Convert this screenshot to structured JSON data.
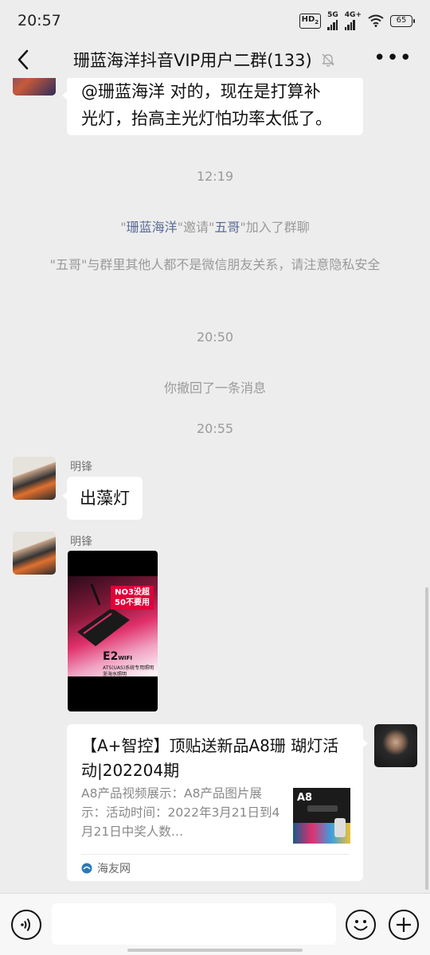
{
  "status_bar": {
    "time": "20:57",
    "hd_label": "HD",
    "hd_sub": "2",
    "net1": "5G",
    "net2": "4G+",
    "battery": "65"
  },
  "nav": {
    "title": "珊蓝海洋抖音VIP用户二群(133)",
    "muted": true
  },
  "messages": {
    "m1_text_line1": "@珊蓝海洋 对的，现在是打算补",
    "m1_text_line2": "光灯，抬高主光灯怕功率太低了。",
    "time1": "12:19",
    "invite_q1": "\"",
    "invite_inviter": "珊蓝海洋",
    "invite_mid": "\"邀请\"",
    "invite_invitee": "五哥",
    "invite_end": "\"加入了群聊",
    "privacy_note": "\"五哥\"与群里其他人都不是微信朋友关系，请注意隐私安全",
    "time2": "20:50",
    "recalled": "你撤回了一条消息",
    "time3": "20:55",
    "m2_sender": "明锋",
    "m2_text": "出藻灯",
    "m3_sender": "明锋",
    "video": {
      "tag": "NO3没超",
      "tag2": "50不要用",
      "model": "E2",
      "model_sub": "WIFI",
      "caption": "ATS(UAS)系统专用照明",
      "caption2": "浙海水照明"
    },
    "card": {
      "title": "【A+智控】顶贴送新品A8珊 瑚灯活动|202204期",
      "desc": "A8产品视频展示：A8产品图片展示：活动时间：2022年3月21日到4月21日中奖人数…",
      "thumb_label": "A8",
      "source": "海友网"
    }
  },
  "input": {
    "placeholder": ""
  },
  "colors": {
    "background": "#ededed",
    "bubble": "#ffffff",
    "link_name": "#576b95",
    "system_text": "#9a9a9a"
  }
}
